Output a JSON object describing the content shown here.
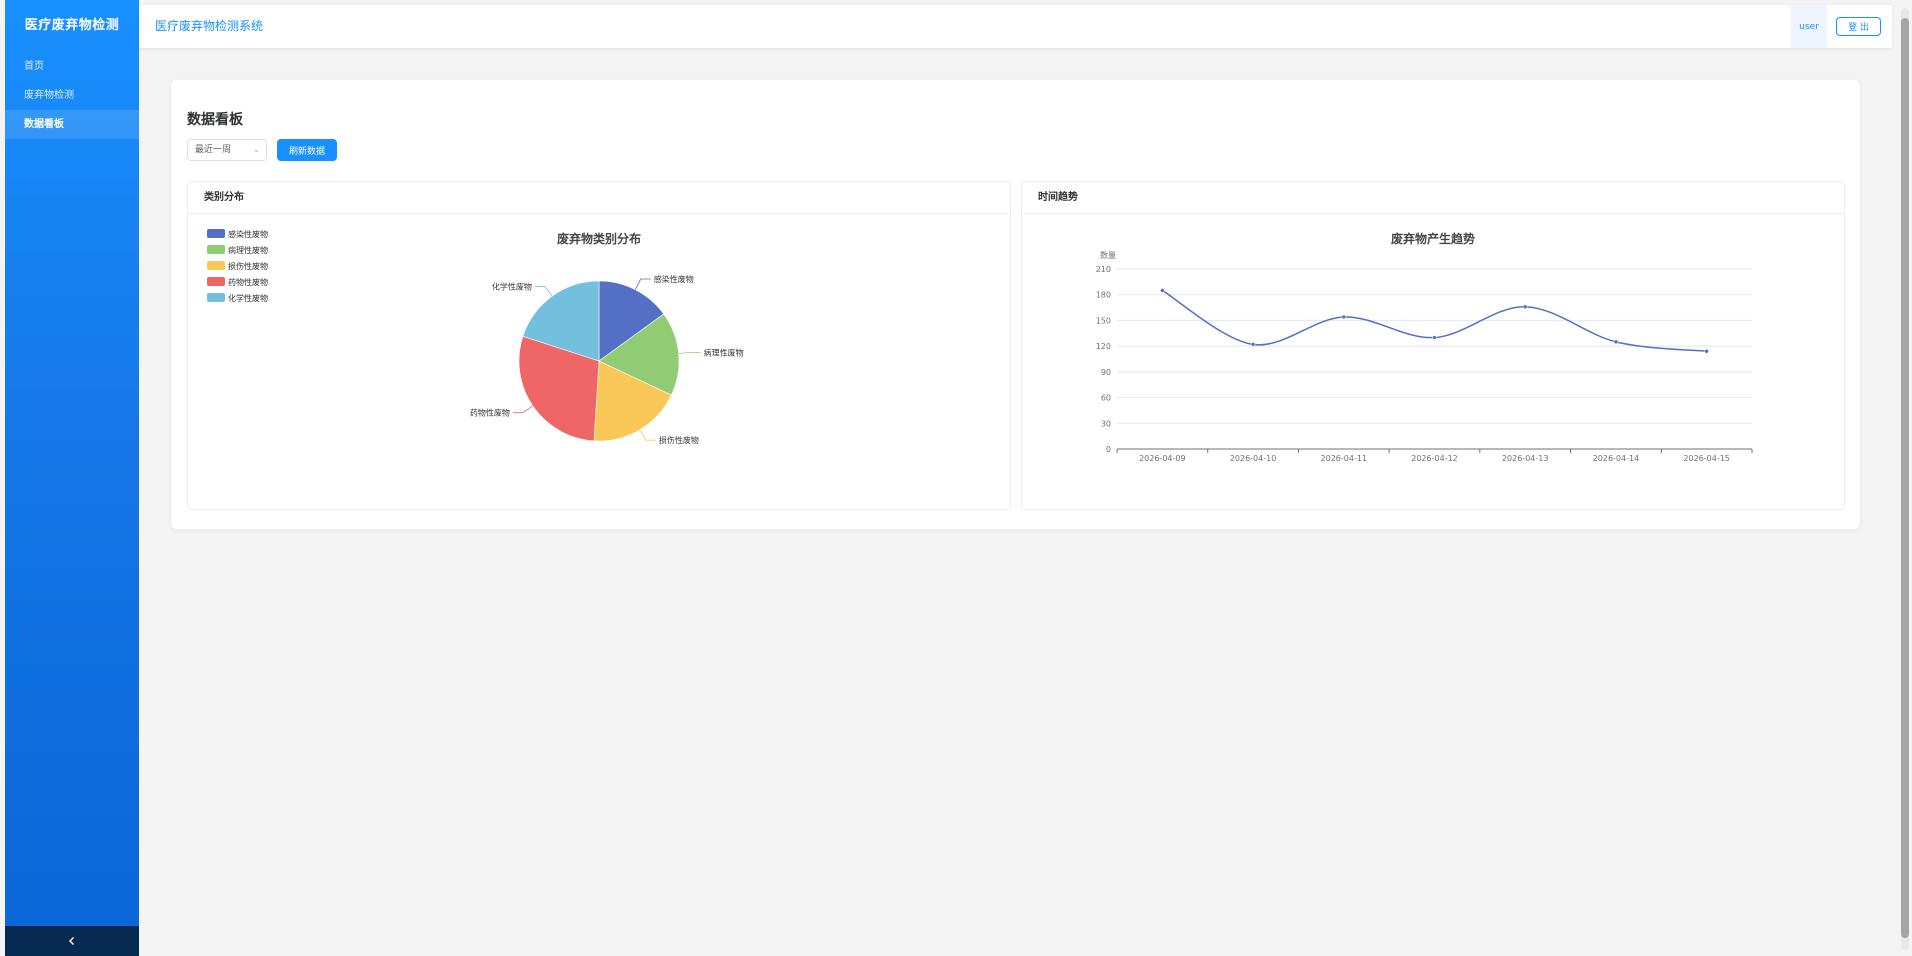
{
  "app": {
    "brand": "医疗废弃物检测",
    "system_title": "医疗废弃物检测系统",
    "user": "user",
    "logout_label": "登 出"
  },
  "sidebar": {
    "items": [
      {
        "label": "首页",
        "active": false
      },
      {
        "label": "废弃物检测",
        "active": false
      },
      {
        "label": "数据看板",
        "active": true
      }
    ],
    "collapse_icon": "chevron-left-icon"
  },
  "dashboard": {
    "title": "数据看板",
    "range_select": {
      "value": "最近一周"
    },
    "refresh_label": "刷新数据",
    "category_panel_title": "类别分布",
    "trend_panel_title": "时间趋势"
  },
  "colors": {
    "primary": "#1890ff",
    "series": [
      "#5470c6",
      "#91cc75",
      "#fac858",
      "#ee6666",
      "#73c0de"
    ]
  },
  "chart_data": [
    {
      "type": "pie",
      "title": "废弃物类别分布",
      "legend_position": "top-left",
      "labels": [
        "感染性废物",
        "病理性废物",
        "损伤性废物",
        "药物性废物",
        "化学性废物"
      ],
      "values": [
        15,
        17,
        19,
        29,
        20
      ]
    },
    {
      "type": "line",
      "title": "废弃物产生趋势",
      "ylabel": "数量",
      "xlabel": "",
      "x": [
        "2026-04-09",
        "2026-04-10",
        "2026-04-11",
        "2026-04-12",
        "2026-04-13",
        "2026-04-14",
        "2026-04-15"
      ],
      "series": [
        {
          "values": [
            185,
            122,
            154,
            130,
            166,
            125,
            114
          ]
        }
      ],
      "ylim": [
        0,
        210
      ],
      "yticks": [
        0,
        30,
        60,
        90,
        120,
        150,
        180,
        210
      ],
      "smooth": true,
      "grid": true
    }
  ]
}
